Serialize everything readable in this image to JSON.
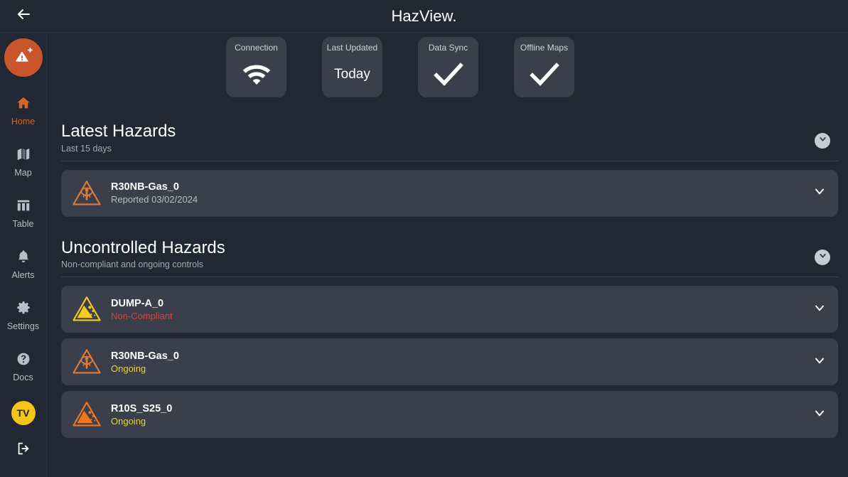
{
  "header": {
    "title": "HazView.",
    "back_icon": "arrow-left-icon"
  },
  "sidebar": {
    "add_button": {
      "icon": "warning-triangle-plus-icon"
    },
    "items": [
      {
        "label": "Home",
        "icon": "home-icon",
        "active": true
      },
      {
        "label": "Map",
        "icon": "map-icon",
        "active": false
      },
      {
        "label": "Table",
        "icon": "table-icon",
        "active": false
      },
      {
        "label": "Alerts",
        "icon": "bell-icon",
        "active": false
      },
      {
        "label": "Settings",
        "icon": "gear-icon",
        "active": false
      },
      {
        "label": "Docs",
        "icon": "question-circle-icon",
        "active": false
      }
    ],
    "avatar": {
      "initials": "TV",
      "color": "#f5c518"
    },
    "logout": {
      "icon": "logout-icon"
    }
  },
  "status_cards": [
    {
      "label": "Connection",
      "icon": "wifi-icon",
      "value": ""
    },
    {
      "label": "Last Updated",
      "icon": "",
      "value": "Today"
    },
    {
      "label": "Data Sync",
      "icon": "check-icon",
      "value": ""
    },
    {
      "label": "Offline Maps",
      "icon": "check-icon",
      "value": ""
    }
  ],
  "sections": [
    {
      "title": "Latest Hazards",
      "subtitle": "Last 15 days",
      "collapse_icon": "chevron-down-icon",
      "rows": [
        {
          "name": "R30NB-Gas_0",
          "meta": "Reported 03/02/2024",
          "meta_state": "default",
          "icon": "hazard-gas-triangle-icon",
          "icon_color": "#e07b39",
          "chevron": "chevron-down-icon"
        }
      ]
    },
    {
      "title": "Uncontrolled Hazards",
      "subtitle": "Non-compliant and ongoing controls",
      "collapse_icon": "chevron-down-icon",
      "rows": [
        {
          "name": "DUMP-A_0",
          "meta": "Non-Compliant",
          "meta_state": "noncompliant",
          "icon": "hazard-rockfall-triangle-icon",
          "icon_color": "#f2cb1d",
          "chevron": "chevron-down-icon"
        },
        {
          "name": "R30NB-Gas_0",
          "meta": "Ongoing",
          "meta_state": "ongoing",
          "icon": "hazard-gas-triangle-icon",
          "icon_color": "#e07b39",
          "chevron": "chevron-down-icon"
        },
        {
          "name": "R10S_S25_0",
          "meta": "Ongoing",
          "meta_state": "ongoing",
          "icon": "hazard-rockfall-triangle-icon",
          "icon_color": "#f2751d",
          "chevron": "chevron-down-icon"
        }
      ]
    }
  ],
  "colors": {
    "background": "#222833",
    "card": "#3a3f4b",
    "accent_orange": "#d4662f",
    "status_red": "#d2483f",
    "status_yellow": "#e4d344"
  }
}
